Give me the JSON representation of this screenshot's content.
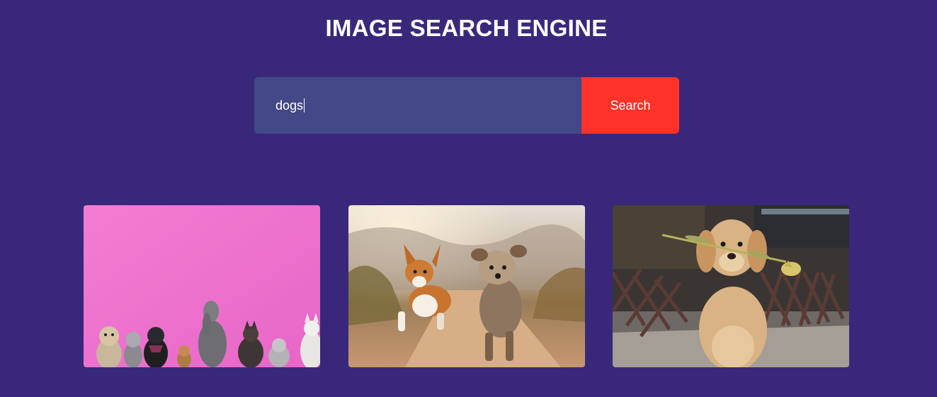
{
  "header": {
    "title": "IMAGE SEARCH ENGINE"
  },
  "search": {
    "query": "dogs",
    "button_label": "Search"
  },
  "results": [
    {
      "name": "dogs-on-pink-wall"
    },
    {
      "name": "corgi-and-terrier-running"
    },
    {
      "name": "golden-retriever-with-tulip"
    }
  ],
  "colors": {
    "background": "#39287a",
    "input_bg": "#434886",
    "button_bg": "#fd3329",
    "text": "#ffffff"
  }
}
